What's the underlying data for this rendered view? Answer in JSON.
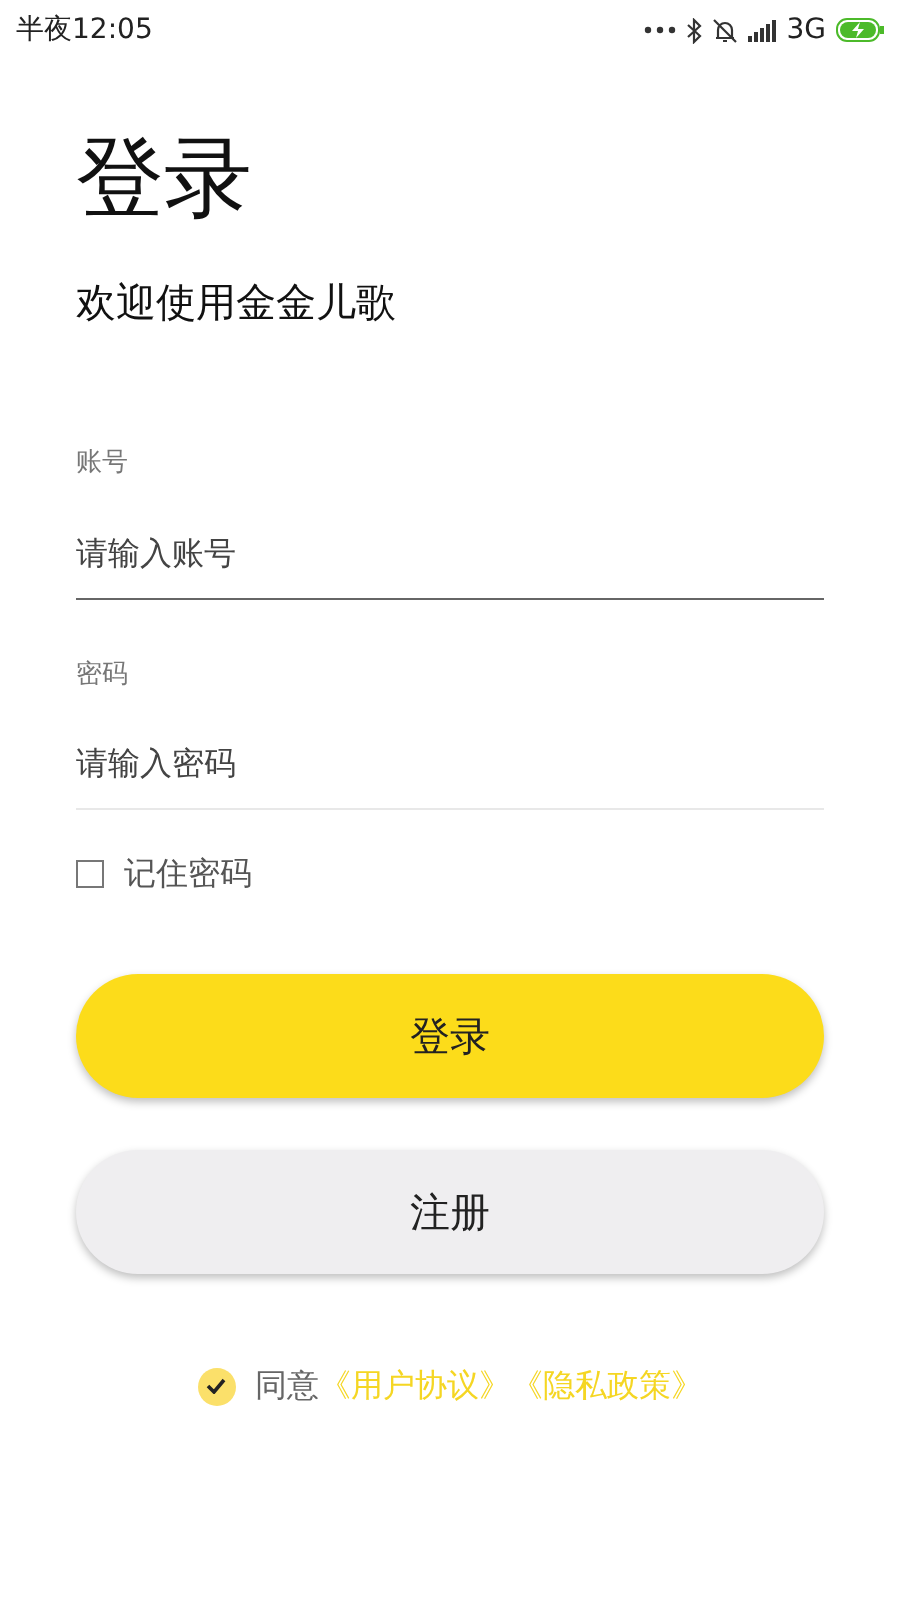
{
  "status_bar": {
    "time": "半夜12:05",
    "network": "3G"
  },
  "title": "登录",
  "subtitle": "欢迎使用金金儿歌",
  "fields": [
    {
      "label": "账号",
      "placeholder": "请输入账号",
      "focused": true
    },
    {
      "label": "密码",
      "placeholder": "请输入密码",
      "focused": false
    }
  ],
  "remember": {
    "label": "记住密码",
    "checked": false
  },
  "buttons": [
    {
      "label": "登录",
      "kind": "primary"
    },
    {
      "label": "注册",
      "kind": "secondary"
    }
  ],
  "agreement": {
    "checked": true,
    "prefix": "同意",
    "links": [
      "《用户协议》",
      "《隐私政策》"
    ]
  }
}
